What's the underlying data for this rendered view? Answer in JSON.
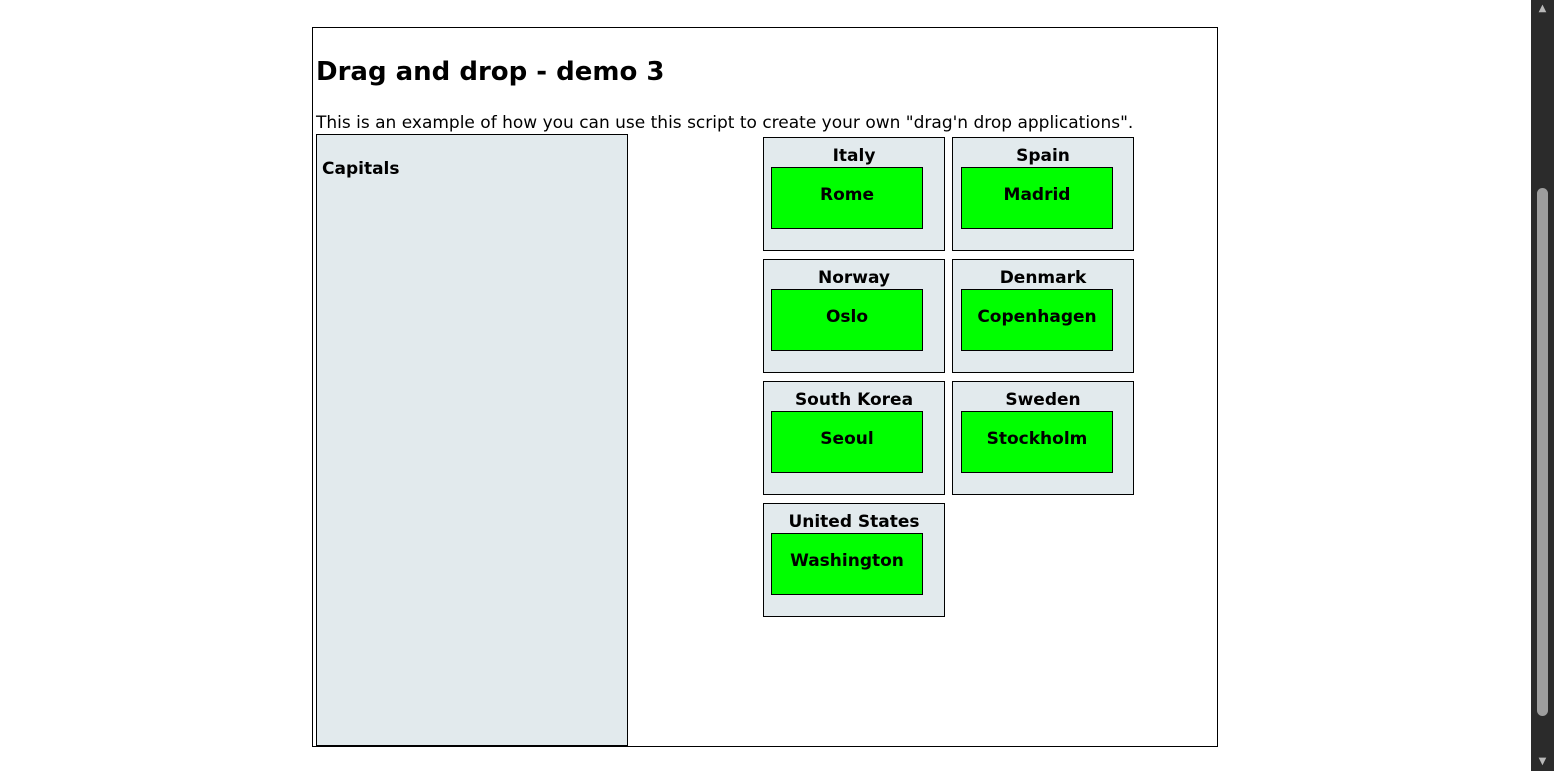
{
  "header": {
    "title": "Drag and drop - demo 3",
    "intro": "This is an example of how you can use this script to create your own \"drag'n drop applications\"."
  },
  "capitals_box": {
    "title": "Capitals"
  },
  "countries": [
    {
      "name": "Italy",
      "capital": "Rome"
    },
    {
      "name": "Spain",
      "capital": "Madrid"
    },
    {
      "name": "Norway",
      "capital": "Oslo"
    },
    {
      "name": "Denmark",
      "capital": "Copenhagen"
    },
    {
      "name": "South Korea",
      "capital": "Seoul"
    },
    {
      "name": "Sweden",
      "capital": "Stockholm"
    },
    {
      "name": "United States",
      "capital": "Washington"
    }
  ],
  "scrollbar": {
    "up_icon": "arrow-up",
    "down_icon": "arrow-down"
  },
  "colors": {
    "capital_fill": "#00ff00",
    "box_fill": "#e2eaed",
    "scrollbar_track": "#2b2b2b",
    "scrollbar_thumb": "#9e9e9e"
  }
}
